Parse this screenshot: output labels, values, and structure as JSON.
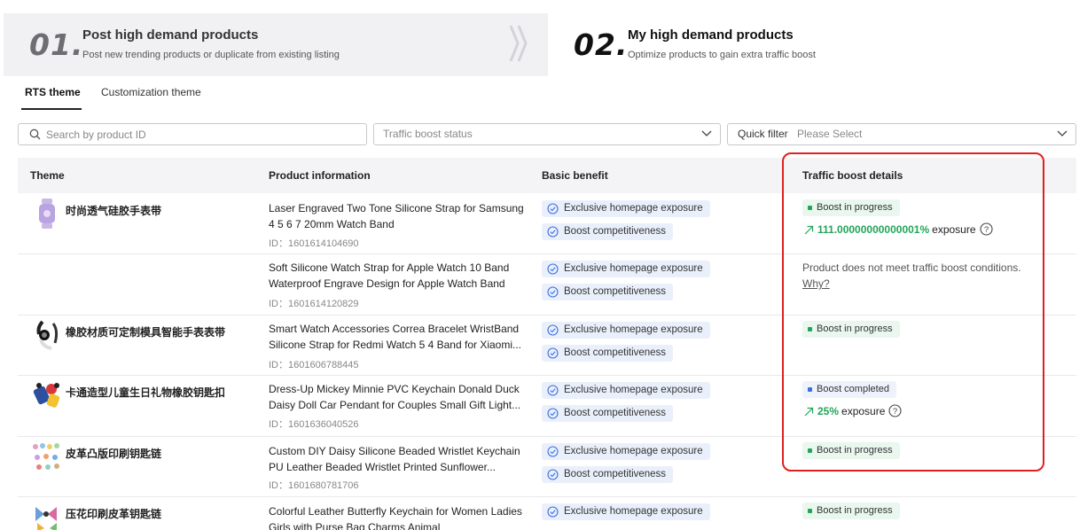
{
  "steps": [
    {
      "num": "01.",
      "title": "Post high demand products",
      "subtitle": "Post new trending products or duplicate from existing listing"
    },
    {
      "num": "02.",
      "title": "My high demand products",
      "subtitle": "Optimize products to gain extra traffic boost"
    }
  ],
  "tabs": [
    {
      "label": "RTS theme",
      "active": true
    },
    {
      "label": "Customization theme",
      "active": false
    }
  ],
  "filters": {
    "search_placeholder": "Search by product ID",
    "status_placeholder": "Traffic boost status",
    "quick_label": "Quick filter",
    "quick_placeholder": "Please Select"
  },
  "table": {
    "headers": {
      "theme": "Theme",
      "product": "Product information",
      "basic": "Basic benefit",
      "traffic": "Traffic boost details"
    },
    "benefit_labels": {
      "homepage": "Exclusive homepage exposure",
      "competitive": "Boost competitiveness"
    },
    "rows": [
      {
        "theme": "时尚透气硅胶手表带",
        "title": "Laser Engraved Two Tone Silicone Strap for Samsung 4 5 6 7 20mm Watch Band",
        "id": "ID：1601614104690",
        "badge": "Boost in progress",
        "exposure_pct": "111.00000000000001%",
        "exposure_label": "exposure"
      },
      {
        "theme": "",
        "title": "Soft Silicone Watch Strap for Apple Watch 10 Band Waterproof Engrave Design for Apple Watch Band",
        "id": "ID：1601614120829",
        "not_meet": "Product does not meet traffic boost conditions.",
        "why": "Why?"
      },
      {
        "theme": "橡胶材质可定制模具智能手表表带",
        "title": "Smart Watch Accessories Correa Bracelet WristBand Silicone Strap for Redmi Watch 5 4 Band for Xiaomi...",
        "id": "ID：1601606788445",
        "badge": "Boost in progress"
      },
      {
        "theme": "卡通造型儿童生日礼物橡胶钥匙扣",
        "title": "Dress-Up Mickey Minnie PVC Keychain Donald Duck Daisy Doll Car Pendant for Couples Small Gift Light...",
        "id": "ID：1601636040526",
        "badge": "Boost completed",
        "exposure_pct": "25%",
        "exposure_label": "exposure"
      },
      {
        "theme": "皮革凸版印刷钥匙链",
        "title": "Custom DIY Daisy Silicone Beaded Wristlet Keychain PU Leather Beaded Wristlet Printed Sunflower...",
        "id": "ID：1601680781706",
        "badge": "Boost in progress"
      },
      {
        "theme": "压花印刷皮革钥匙链",
        "title": "Colorful Leather Butterfly Keychain for Women Ladies Girls with Purse Bag Charms Animal",
        "badge": "Boost in progress"
      }
    ]
  },
  "colors": {
    "accent_green": "#22a55a",
    "accent_blue": "#3b6fe0",
    "highlight_red": "#e02020"
  }
}
